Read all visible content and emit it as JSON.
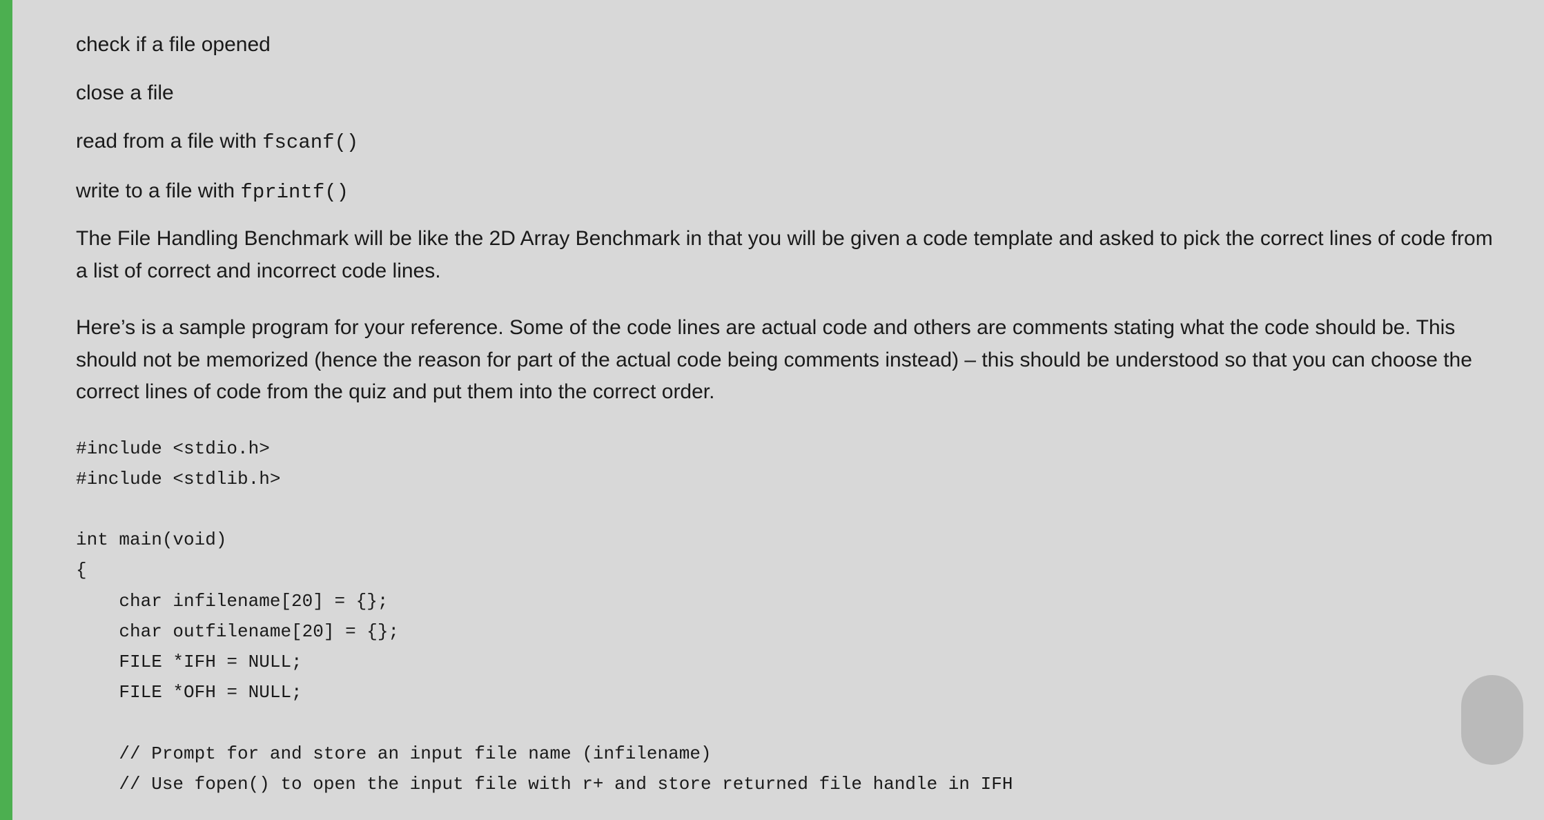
{
  "bullet_items": [
    {
      "text_before": "check if a file opened",
      "code": "",
      "text_after": ""
    },
    {
      "text_before": "close a file",
      "code": "",
      "text_after": ""
    },
    {
      "text_before": "read from a file with ",
      "code": "fscanf()",
      "text_after": ""
    },
    {
      "text_before": "write to a file with ",
      "code": "fprintf()",
      "text_after": ""
    }
  ],
  "paragraph1": "The File Handling Benchmark will be like the 2D Array Benchmark in that you will be given a code template and asked to pick the correct lines of code from a list of correct and incorrect code lines.",
  "paragraph2": "Here’s is a sample program for your reference.  Some of the code lines are actual code and others are comments stating what the code should be.  This should not be memorized (hence the reason for part of the actual code being comments instead) – this should be understood so that you can choose the correct lines of code from the quiz and put them into the correct order.",
  "code_block": "#include <stdio.h>\n#include <stdlib.h>\n\nint main(void)\n{\n    char infilename[20] = {};\n    char outfilename[20] = {};\n    FILE *IFH = NULL;\n    FILE *OFH = NULL;\n\n    // Prompt for and store an input file name (infilename)\n    // Use fopen() to open the input file with r+ and store returned file handle in IFH"
}
